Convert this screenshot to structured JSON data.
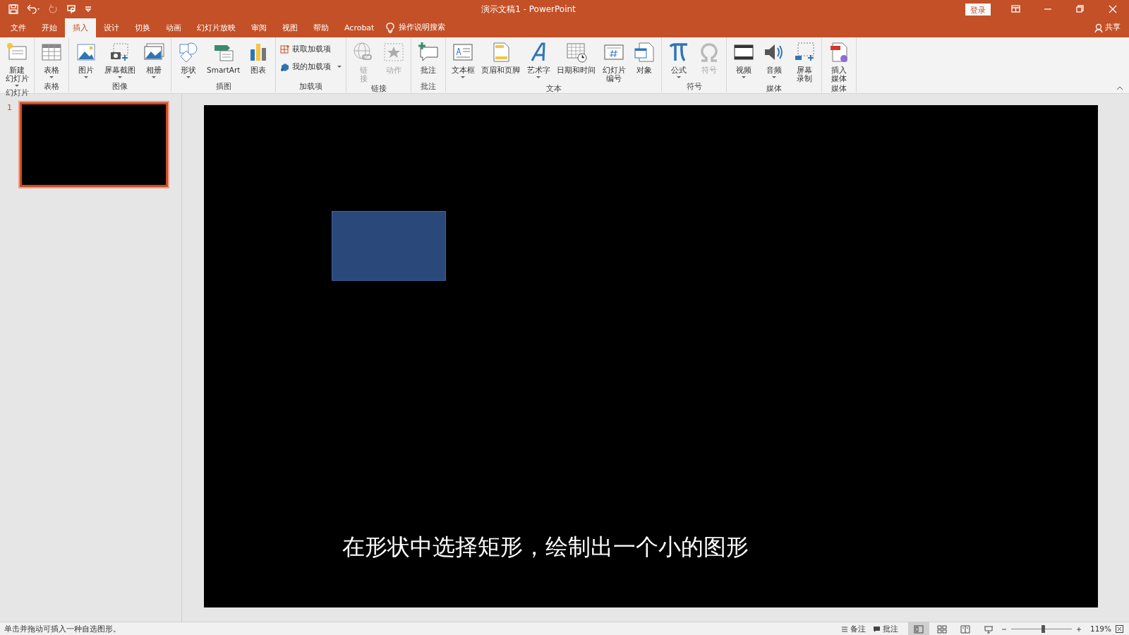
{
  "window": {
    "title": "演示文稿1  -  PowerPoint",
    "sign_in": "登录"
  },
  "tabs": [
    {
      "label": "文件",
      "selected": false
    },
    {
      "label": "开始",
      "selected": false
    },
    {
      "label": "插入",
      "selected": true
    },
    {
      "label": "设计",
      "selected": false
    },
    {
      "label": "切换",
      "selected": false
    },
    {
      "label": "动画",
      "selected": false
    },
    {
      "label": "幻灯片放映",
      "selected": false
    },
    {
      "label": "审阅",
      "selected": false
    },
    {
      "label": "视图",
      "selected": false
    },
    {
      "label": "帮助",
      "selected": false
    },
    {
      "label": "Acrobat",
      "selected": false
    }
  ],
  "tell_me": "操作说明搜索",
  "share": "共享",
  "ribbon": [
    {
      "label": "幻灯片",
      "buttons": [
        {
          "kind": "large",
          "lines": [
            "新建",
            "幻灯片"
          ],
          "dropdown": true,
          "disabled": false
        }
      ]
    },
    {
      "label": "表格",
      "buttons": [
        {
          "kind": "large",
          "lines": [
            "表格"
          ],
          "dropdown": true,
          "disabled": false
        }
      ]
    },
    {
      "label": "图像",
      "buttons": [
        {
          "kind": "large",
          "lines": [
            "图片"
          ],
          "dropdown": true,
          "disabled": false
        },
        {
          "kind": "large",
          "lines": [
            "屏幕截图"
          ],
          "dropdown": true,
          "disabled": false
        },
        {
          "kind": "large",
          "lines": [
            "相册"
          ],
          "dropdown": true,
          "disabled": false
        }
      ]
    },
    {
      "label": "插图",
      "buttons": [
        {
          "kind": "large",
          "lines": [
            "形状"
          ],
          "dropdown": true,
          "disabled": false
        },
        {
          "kind": "large",
          "lines": [
            "SmartArt"
          ],
          "dropdown": false,
          "disabled": false
        },
        {
          "kind": "large",
          "lines": [
            "图表"
          ],
          "dropdown": false,
          "disabled": false
        }
      ]
    },
    {
      "label": "加载项",
      "buttons": [
        {
          "kind": "small",
          "lines": [
            "获取加载项"
          ],
          "dropdown": false,
          "disabled": false
        },
        {
          "kind": "small",
          "lines": [
            "我的加载项"
          ],
          "dropdown": true,
          "disabled": false
        }
      ]
    },
    {
      "label": "链接",
      "buttons": [
        {
          "kind": "large",
          "lines": [
            "链",
            "接"
          ],
          "dropdown": false,
          "disabled": true
        },
        {
          "kind": "large",
          "lines": [
            "动作"
          ],
          "dropdown": false,
          "disabled": true
        }
      ]
    },
    {
      "label": "批注",
      "buttons": [
        {
          "kind": "large",
          "lines": [
            "批注"
          ],
          "dropdown": false,
          "disabled": false
        }
      ]
    },
    {
      "label": "文本",
      "buttons": [
        {
          "kind": "large",
          "lines": [
            "文本框"
          ],
          "dropdown": true,
          "disabled": false
        },
        {
          "kind": "large",
          "lines": [
            "页眉和页脚"
          ],
          "dropdown": false,
          "disabled": false
        },
        {
          "kind": "large",
          "lines": [
            "艺术字"
          ],
          "dropdown": true,
          "disabled": false
        },
        {
          "kind": "large",
          "lines": [
            "日期和时间"
          ],
          "dropdown": false,
          "disabled": false
        },
        {
          "kind": "large",
          "lines": [
            "幻灯片",
            "编号"
          ],
          "dropdown": false,
          "disabled": false
        },
        {
          "kind": "large",
          "lines": [
            "对象"
          ],
          "dropdown": false,
          "disabled": false
        }
      ]
    },
    {
      "label": "符号",
      "buttons": [
        {
          "kind": "large",
          "lines": [
            "公式"
          ],
          "dropdown": true,
          "disabled": false
        },
        {
          "kind": "large",
          "lines": [
            "符号"
          ],
          "dropdown": false,
          "disabled": true
        }
      ]
    },
    {
      "label": "媒体",
      "buttons": [
        {
          "kind": "large",
          "lines": [
            "视频"
          ],
          "dropdown": true,
          "disabled": false
        },
        {
          "kind": "large",
          "lines": [
            "音频"
          ],
          "dropdown": true,
          "disabled": false
        },
        {
          "kind": "large",
          "lines": [
            "屏幕",
            "录制"
          ],
          "dropdown": false,
          "disabled": false
        }
      ]
    },
    {
      "label": "媒体",
      "buttons": [
        {
          "kind": "large",
          "lines": [
            "插入",
            "媒体"
          ],
          "dropdown": false,
          "disabled": false
        }
      ]
    }
  ],
  "slides": [
    {
      "number": "1",
      "selected": true
    }
  ],
  "slide": {
    "caption": "在形状中选择矩形，绘制出一个小的图形"
  },
  "status_bar": {
    "message": "单击并拖动可插入一种自选图形。",
    "notes": "备注",
    "comments": "批注",
    "views": [
      {
        "selected": true
      },
      {
        "selected": false
      },
      {
        "selected": false
      },
      {
        "selected": false
      }
    ],
    "zoom": {
      "level": 0.52,
      "reading": "119%"
    }
  }
}
